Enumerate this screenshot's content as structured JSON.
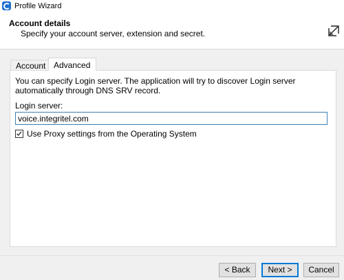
{
  "window": {
    "title": "Profile Wizard"
  },
  "header": {
    "title": "Account details",
    "subtitle": "Specify your account server, extension and secret."
  },
  "tabs": [
    {
      "label": "Account",
      "active": false
    },
    {
      "label": "Advanced",
      "active": true
    }
  ],
  "advanced": {
    "description": "You can specify Login server. The application will try to discover Login server automatically through DNS SRV record.",
    "login_server_label": "Login server:",
    "login_server_value": "voice.integritel.com",
    "proxy_label": "Use Proxy settings from the Operating System",
    "proxy_checked": true
  },
  "buttons": {
    "back": "< Back",
    "next": "Next >",
    "cancel": "Cancel"
  },
  "icons": {
    "app": "app-logo-icon",
    "header": "resize-expand-icon",
    "check": "checkmark-icon"
  },
  "colors": {
    "accent": "#0078d7",
    "input_border": "#3c7fb1",
    "app_icon": "#1e6fd0"
  }
}
